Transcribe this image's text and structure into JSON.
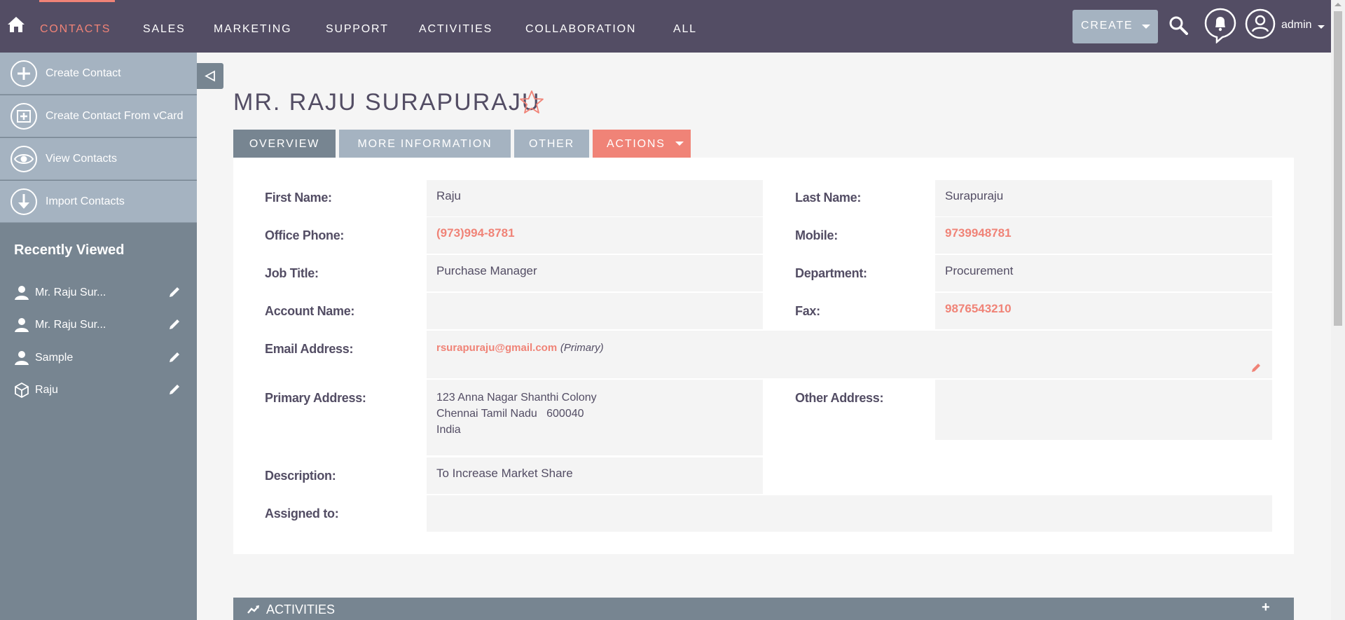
{
  "nav": {
    "items": [
      "CONTACTS",
      "SALES",
      "MARKETING",
      "SUPPORT",
      "ACTIVITIES",
      "COLLABORATION",
      "ALL"
    ],
    "create_label": "CREATE",
    "user_name": "admin"
  },
  "sidebar": {
    "actions": [
      "Create Contact",
      "Create Contact From vCard",
      "View Contacts",
      "Import Contacts"
    ],
    "recent_title": "Recently Viewed",
    "recent": [
      {
        "label": "Mr. Raju Sur...",
        "icon": "person-icon"
      },
      {
        "label": "Mr. Raju Sur...",
        "icon": "person-icon"
      },
      {
        "label": "Sample",
        "icon": "person-icon"
      },
      {
        "label": "Raju",
        "icon": "cube-icon"
      }
    ]
  },
  "page": {
    "title": "MR. RAJU SURAPURAJU"
  },
  "tabs": {
    "overview": "OVERVIEW",
    "more": "MORE INFORMATION",
    "other": "OTHER",
    "actions": "ACTIONS"
  },
  "fields": {
    "first_name": {
      "label": "First Name:",
      "value": "Raju"
    },
    "last_name": {
      "label": "Last Name:",
      "value": "Surapuraju"
    },
    "office_phone": {
      "label": "Office Phone:",
      "value": "(973)994-8781"
    },
    "mobile": {
      "label": "Mobile:",
      "value": "9739948781"
    },
    "job_title": {
      "label": "Job Title:",
      "value": "Purchase Manager"
    },
    "department": {
      "label": "Department:",
      "value": "Procurement"
    },
    "account_name": {
      "label": "Account Name:",
      "value": ""
    },
    "fax": {
      "label": "Fax:",
      "value": "9876543210"
    },
    "email": {
      "label": "Email Address:",
      "value": "rsurapuraju@gmail.com",
      "tag": "(Primary)"
    },
    "primary_address": {
      "label": "Primary Address:",
      "line1": "123 Anna Nagar Shanthi Colony",
      "line2": "Chennai Tamil Nadu   600040",
      "line3": "India"
    },
    "other_address": {
      "label": "Other Address:",
      "value": ""
    },
    "description": {
      "label": "Description:",
      "value": "To Increase Market Share"
    },
    "assigned_to": {
      "label": "Assigned to:",
      "value": ""
    }
  },
  "activities": {
    "label": "ACTIVITIES",
    "add": "+"
  },
  "colors": {
    "nav_bg": "#534d64",
    "accent": "#f08377",
    "sidebar_bg": "#778591",
    "sidebar_action_bg": "#a5b3c1"
  }
}
